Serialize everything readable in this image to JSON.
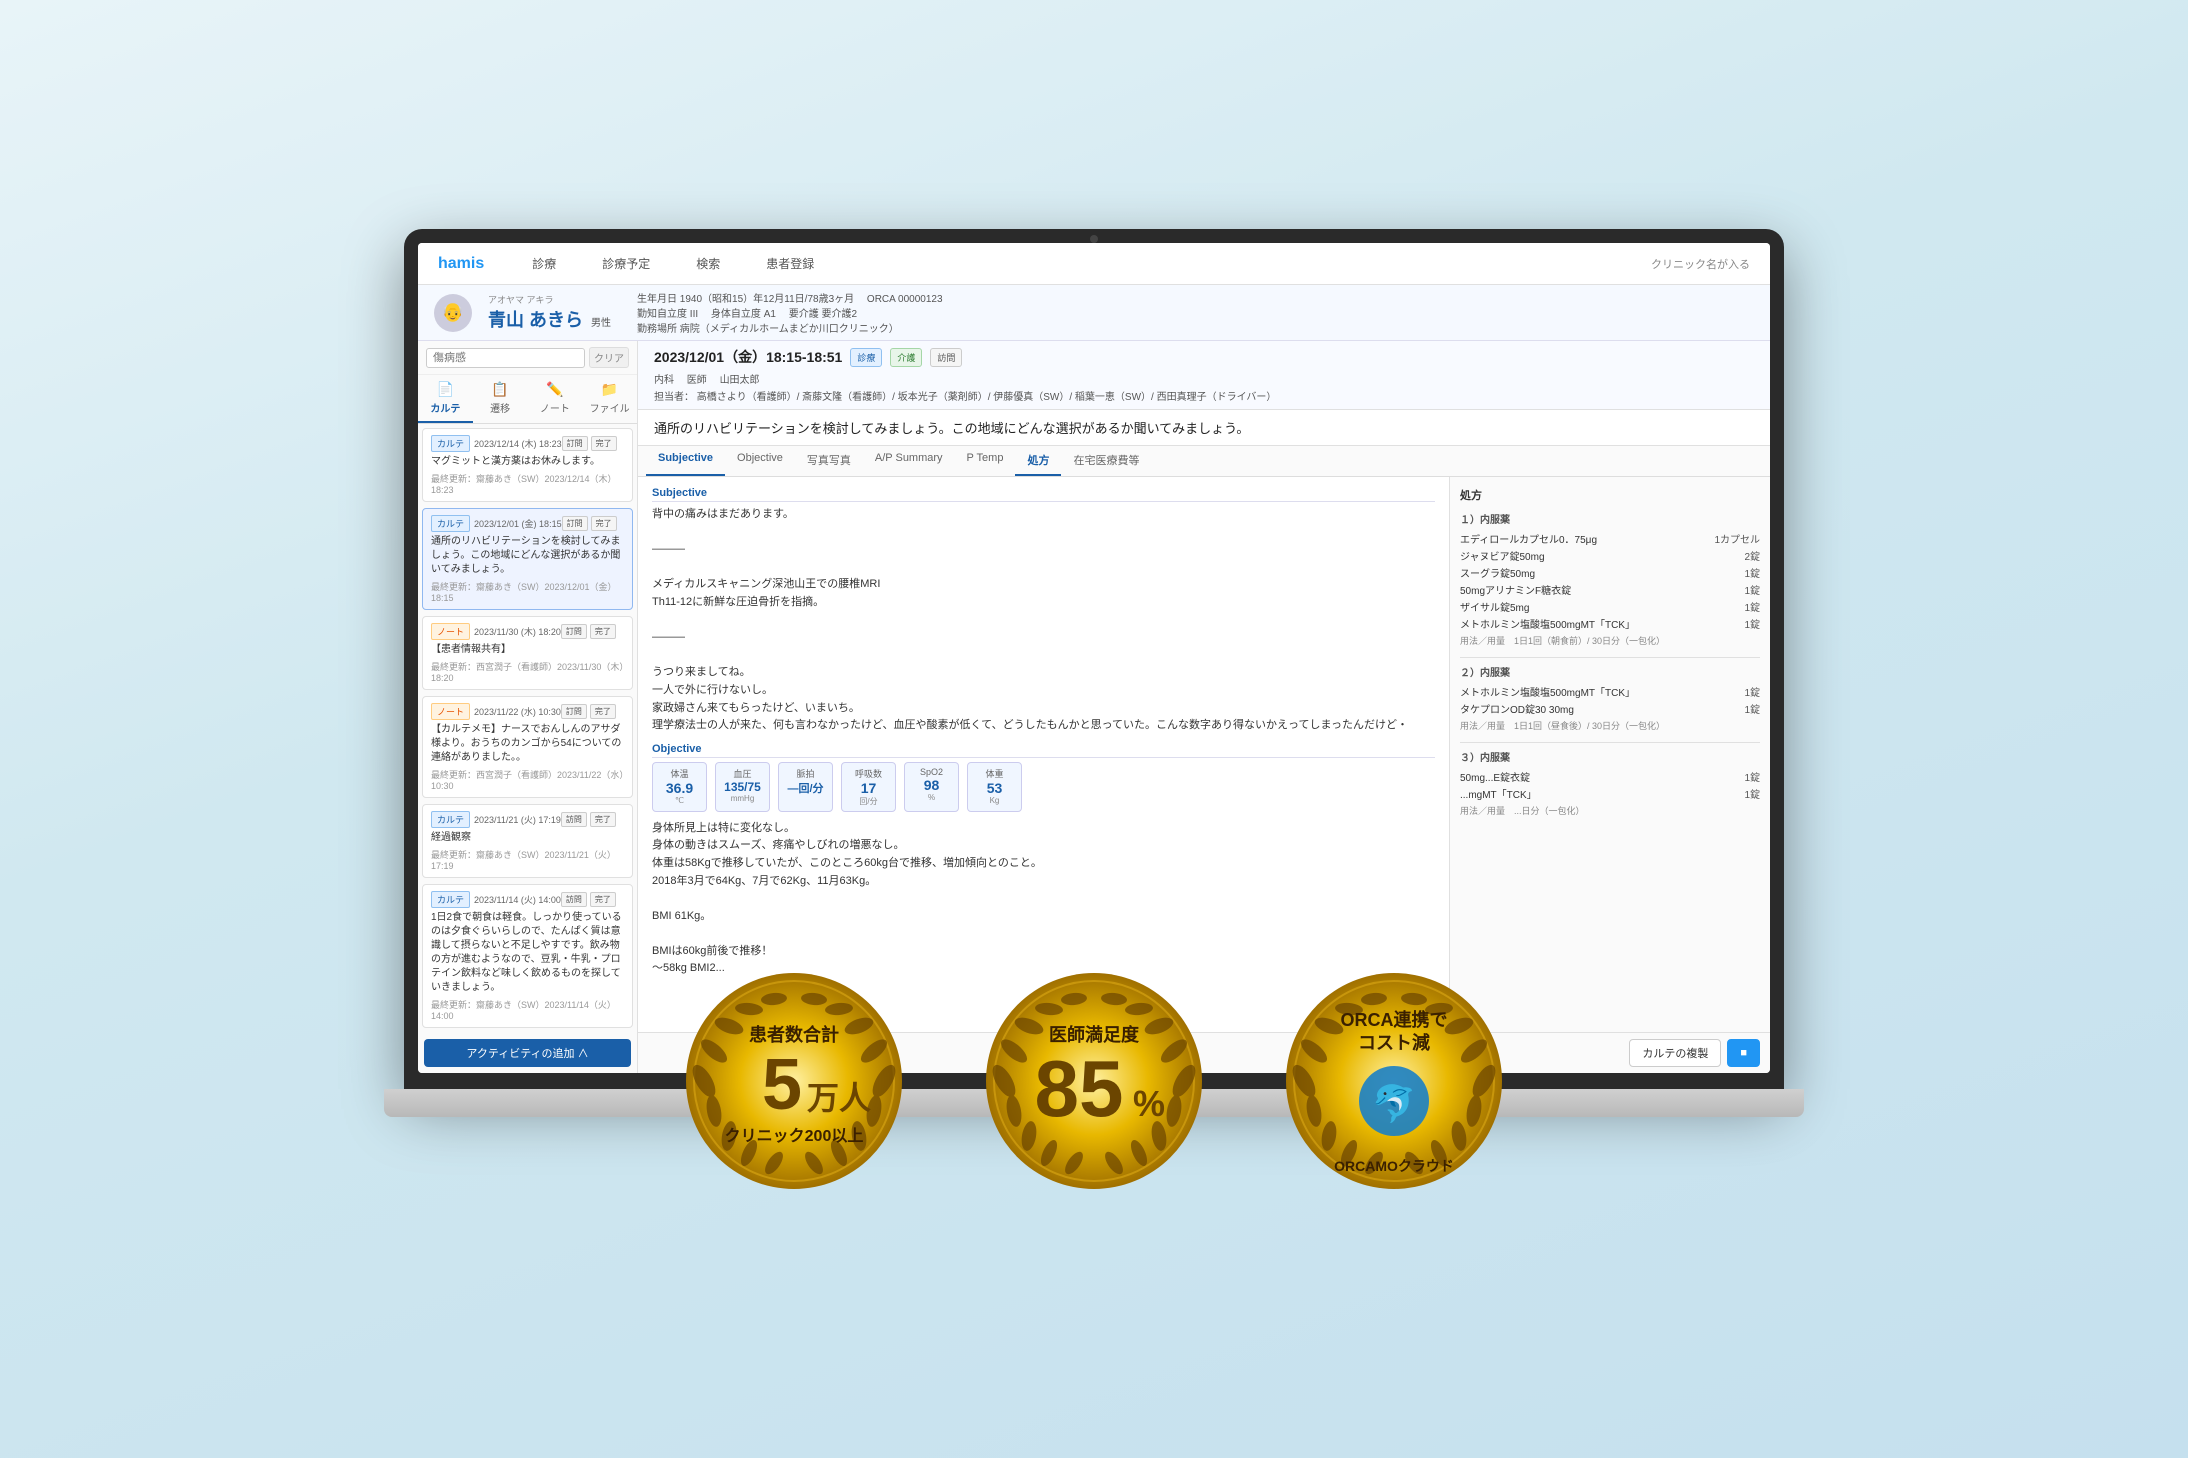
{
  "app": {
    "logo": "hamis",
    "nav": [
      "診療",
      "診療予定",
      "検索",
      "患者登録"
    ],
    "clinic": "クリニック名が入る"
  },
  "patient": {
    "kana": "アオヤマ アキラ",
    "name": "青山 あきら",
    "gender": "男性",
    "birthdate": "生年月日 1940（昭和15）年12月11日/78歳3ヶ月",
    "orca": "ORCA 00000123",
    "facility": "勤知自立度 III",
    "adl": "身体自立度 A1",
    "care": "要介護 要介護2",
    "workplace": "勤務場所 病院（メディカルホームまどか川口クリニック）"
  },
  "search": {
    "placeholder": "傷病感"
  },
  "sidebar_tabs": [
    "カルテ",
    "遷移",
    "ノート",
    "ファイル"
  ],
  "records": [
    {
      "type": "カルテ",
      "date": "2023/12/14 (木) 18:23",
      "content": "マグミットと漢方薬はお休みします。",
      "updated": "最終更新：齋藤あき（SW）2023/12/14（木）18:23",
      "actions": [
        "訂問",
        "完了"
      ]
    },
    {
      "type": "カルテ",
      "date": "2023/12/01 (金) 18:15",
      "content": "通所のリハビリテーションを検討してみましょう。この地域にどんな選択があるか聞いてみましょう。",
      "updated": "最終更新：齋藤あき（SW）2023/12/01（金）18:15",
      "actions": [
        "訂問",
        "完了"
      ]
    },
    {
      "type": "ノート",
      "date": "2023/11/30 (木) 18:20",
      "content": "【患者情報共有】",
      "updated": "最終更新：西宮潤子（看護師）2023/11/30（木）18:20",
      "actions": [
        "訂問",
        "完了"
      ]
    },
    {
      "type": "ノート",
      "date": "2023/11/22 (水) 10:30",
      "content": "【カルテメモ】ナースでおんしんのアサダ様より。おうちのカンゴから54についての連絡がありました。。",
      "updated": "最終更新：西宮潤子（看護師）2023/11/22（水）10:30",
      "actions": [
        "訂問",
        "完了"
      ]
    },
    {
      "type": "カルテ",
      "date": "2023/11/21 (火) 17:19",
      "content": "経過観察",
      "updated": "最終更新：齋藤あき（SW）2023/11/21（火）17:19",
      "actions": [
        "訪問",
        "完了"
      ]
    },
    {
      "type": "カルテ",
      "date": "2023/11/14 (火) 14:00",
      "content": "1日2食で朝食は軽食。しっかり使っているのは夕食ぐらいらしので、たんぱく質は意識して摂らないと不足しやすです。飲み物の方が進むようなので、豆乳・牛乳・プロテイン飲料など味しく飲めるものを探していきましょう。",
      "updated": "最終更新：齋藤あき（SW）2023/11/14（火）14:00",
      "actions": [
        "訪問",
        "完了"
      ]
    }
  ],
  "add_activity_label": "アクティビティの追加 ∧",
  "current_record": {
    "date": "2023/12/01（金）18:15-18:51",
    "statuses": [
      "診療",
      "介護",
      "訪問"
    ],
    "dept": "内科",
    "doctor": "山田太郎",
    "staff": "高橋さより（看護師）/ 斎藤文隆（看護師）/ 坂本光子（薬剤師）/ 伊藤優真（SW）/ 稲葉一恵（SW）/ 西田真理子（ドライバー）",
    "summary": "通所のリハビリテーションを検討してみましょう。この地域にどんな選択があるか聞いてみましょう。"
  },
  "content_tabs": [
    "Subjective",
    "Objective",
    "写真写真",
    "A/P Summary",
    "P Temp",
    "処方",
    "在宅医療費等"
  ],
  "active_tab": "処方",
  "soap": {
    "subjective_label": "Subjective",
    "subjective_text": "背中の痛みはまだあります。\n\n———\n\nメディカルスキャニング深池山王での腰椎MRI\nTh11-12に新鮮な圧迫骨折を指摘。\n\n———\n\nうつり来ましてね。\n一人で外に行けないし。\n家政婦さん来てもらったけど、いまいち。\n理学療法士の人が来た、何も言わなかったけど、血圧や酸素が低くて、どうしたもんかと思っていた。こんな数字あり得ないかえってしまったんだけど・",
    "objective_label": "Objective",
    "vitals": [
      {
        "label": "体温",
        "value": "36.9",
        "unit": "℃"
      },
      {
        "label": "血圧",
        "value": "135/75",
        "unit": "mmHg"
      },
      {
        "label": "脈拍",
        "value": "—回/分",
        "unit": ""
      },
      {
        "label": "呼吸数",
        "value": "17",
        "unit": "回/分"
      },
      {
        "label": "SpO2",
        "value": "98",
        "unit": "%"
      },
      {
        "label": "体重",
        "value": "53",
        "unit": "Kg"
      }
    ],
    "objective_text": "身体所見上は特に変化なし。\n身体の動きはスムーズ、疼痛やしびれの増悪なし。\n体重は58Kgで推移していたが、このところ60kg台で推移、増加傾向とのこと。\n2018年3月で64Kg、7月で62Kg、11月63Kg。\n\nBMI 61Kg。\n\nBMIは60kg前後で推移！\n～58kg BMI2..."
  },
  "prescription": {
    "title": "処方",
    "sections": [
      {
        "num": "１）内服薬",
        "drugs": [
          {
            "name": "エディロールカプセル0．75μg",
            "qty": "1カプセル"
          },
          {
            "name": "ジャヌビア錠50mg",
            "qty": "2錠"
          },
          {
            "name": "スーグラ錠50mg",
            "qty": "1錠"
          },
          {
            "name": "50mgアリナミンF糖衣錠",
            "qty": "1錠"
          },
          {
            "name": "ザイサル錠5mg",
            "qty": "1錠"
          },
          {
            "name": "メトホルミン塩酸塩500mgMT「TCK」",
            "qty": "1錠"
          }
        ],
        "instruction": "用法／用量　1日1回（朝食前）/ 30日分（一包化）"
      },
      {
        "num": "２）内服薬",
        "drugs": [
          {
            "name": "メトホルミン塩酸塩500mgMT「TCK」",
            "qty": "1錠"
          },
          {
            "name": "タケプロンOD錠30 30mg",
            "qty": "1錠"
          }
        ],
        "instruction": "用法／用量　1日1回（昼食後）/ 30日分（一包化）"
      },
      {
        "num": "３）内服薬",
        "drugs": [
          {
            "name": "50mg...E錠衣錠",
            "qty": "1錠"
          },
          {
            "name": "...mgMT「TCK」",
            "qty": "1錠"
          }
        ],
        "instruction": "用法／用量　...日分（一包化）"
      }
    ]
  },
  "footer_buttons": [
    "カルテの複製",
    ""
  ],
  "medals": [
    {
      "top_label": "患者数合計",
      "number": "5",
      "unit": "万人",
      "subtitle": "クリニック200以上"
    },
    {
      "top_label": "医師満足度",
      "number": "85",
      "unit": "%",
      "subtitle": ""
    },
    {
      "top_label": "ORCA連携で",
      "top_label2": "コスト減",
      "number": "",
      "unit": "",
      "subtitle": "ORCAMOクラウド",
      "icon": "🐬"
    }
  ]
}
